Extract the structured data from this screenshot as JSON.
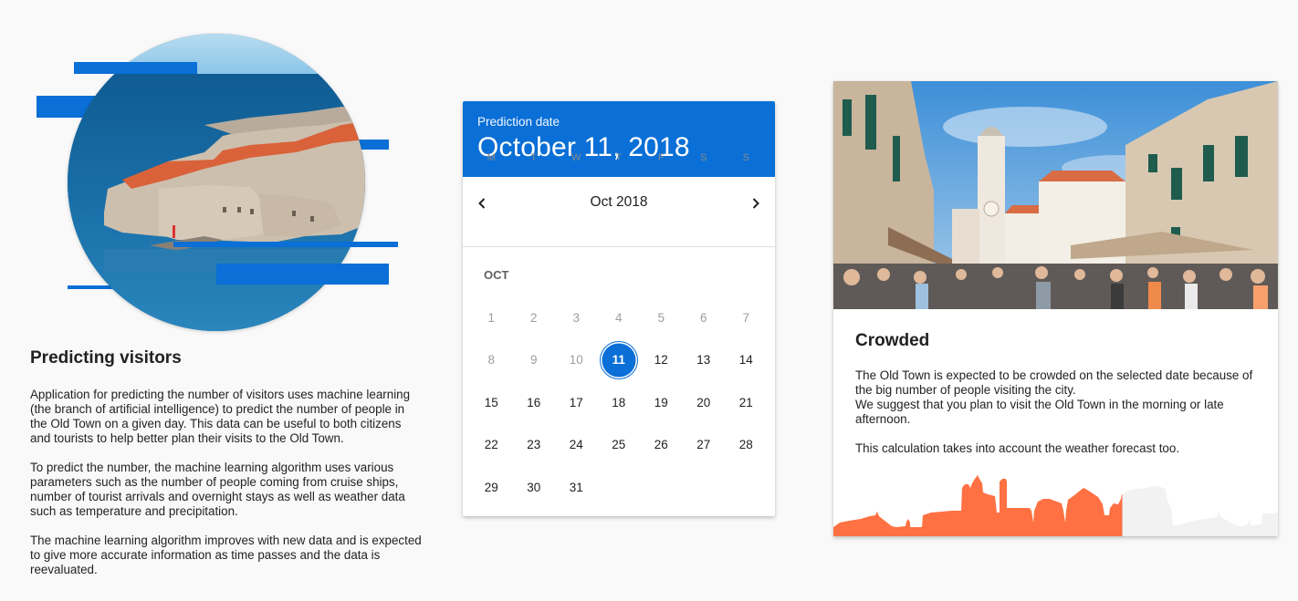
{
  "hero": {
    "image_alt": "Dubrovnik Old Town seen from the sea",
    "accent_color": "#0a6fd6"
  },
  "intro": {
    "title": "Predicting visitors",
    "paragraphs": [
      "Application for predicting the number of visitors uses machine learning (the branch of artificial intelligence) to predict the number of people in the Old Town on a given day. This data can be useful to both citizens and tourists to help better plan their visits to the Old Town.",
      "To predict the number, the machine learning algorithm uses various parameters such as the number of people coming from cruise ships, number of tourist arrivals and overnight stays as well as weather data such as temperature and precipitation.",
      "The machine learning algorithm improves with new data and is expected to give more accurate information as time passes and the data is reevaluated."
    ]
  },
  "calendar": {
    "header_label": "Prediction date",
    "selected_date_text": "October 11, 2018",
    "month_year": "Oct 2018",
    "prev_icon": "chevron-left-icon",
    "next_icon": "chevron-right-icon",
    "weekdays": [
      "M",
      "T",
      "W",
      "T",
      "F",
      "S",
      "S"
    ],
    "month_label": "OCT",
    "first_weekday_offset": 0,
    "days": [
      "1",
      "2",
      "3",
      "4",
      "5",
      "6",
      "7",
      "8",
      "9",
      "10",
      "11",
      "12",
      "13",
      "14",
      "15",
      "16",
      "17",
      "18",
      "19",
      "20",
      "21",
      "22",
      "23",
      "24",
      "25",
      "26",
      "27",
      "28",
      "29",
      "30",
      "31"
    ],
    "disabled_through": 10,
    "selected_day": 11,
    "accent_color": "#0a6fd6"
  },
  "result": {
    "image_alt": "Crowds on Stradun near the bell tower in Dubrovnik",
    "title": "Crowded",
    "paragraph_lines": [
      "The Old Town is expected to be crowded on the selected date because of the big number of people visiting the city.",
      "We suggest that you plan to visit the Old Town in the morning or late afternoon."
    ],
    "note": "This calculation takes into account the weather forecast too.",
    "crowd_level_percent": 65,
    "crowd_fill_color": "#ff7142",
    "crowd_empty_color": "#f2f2f2"
  }
}
